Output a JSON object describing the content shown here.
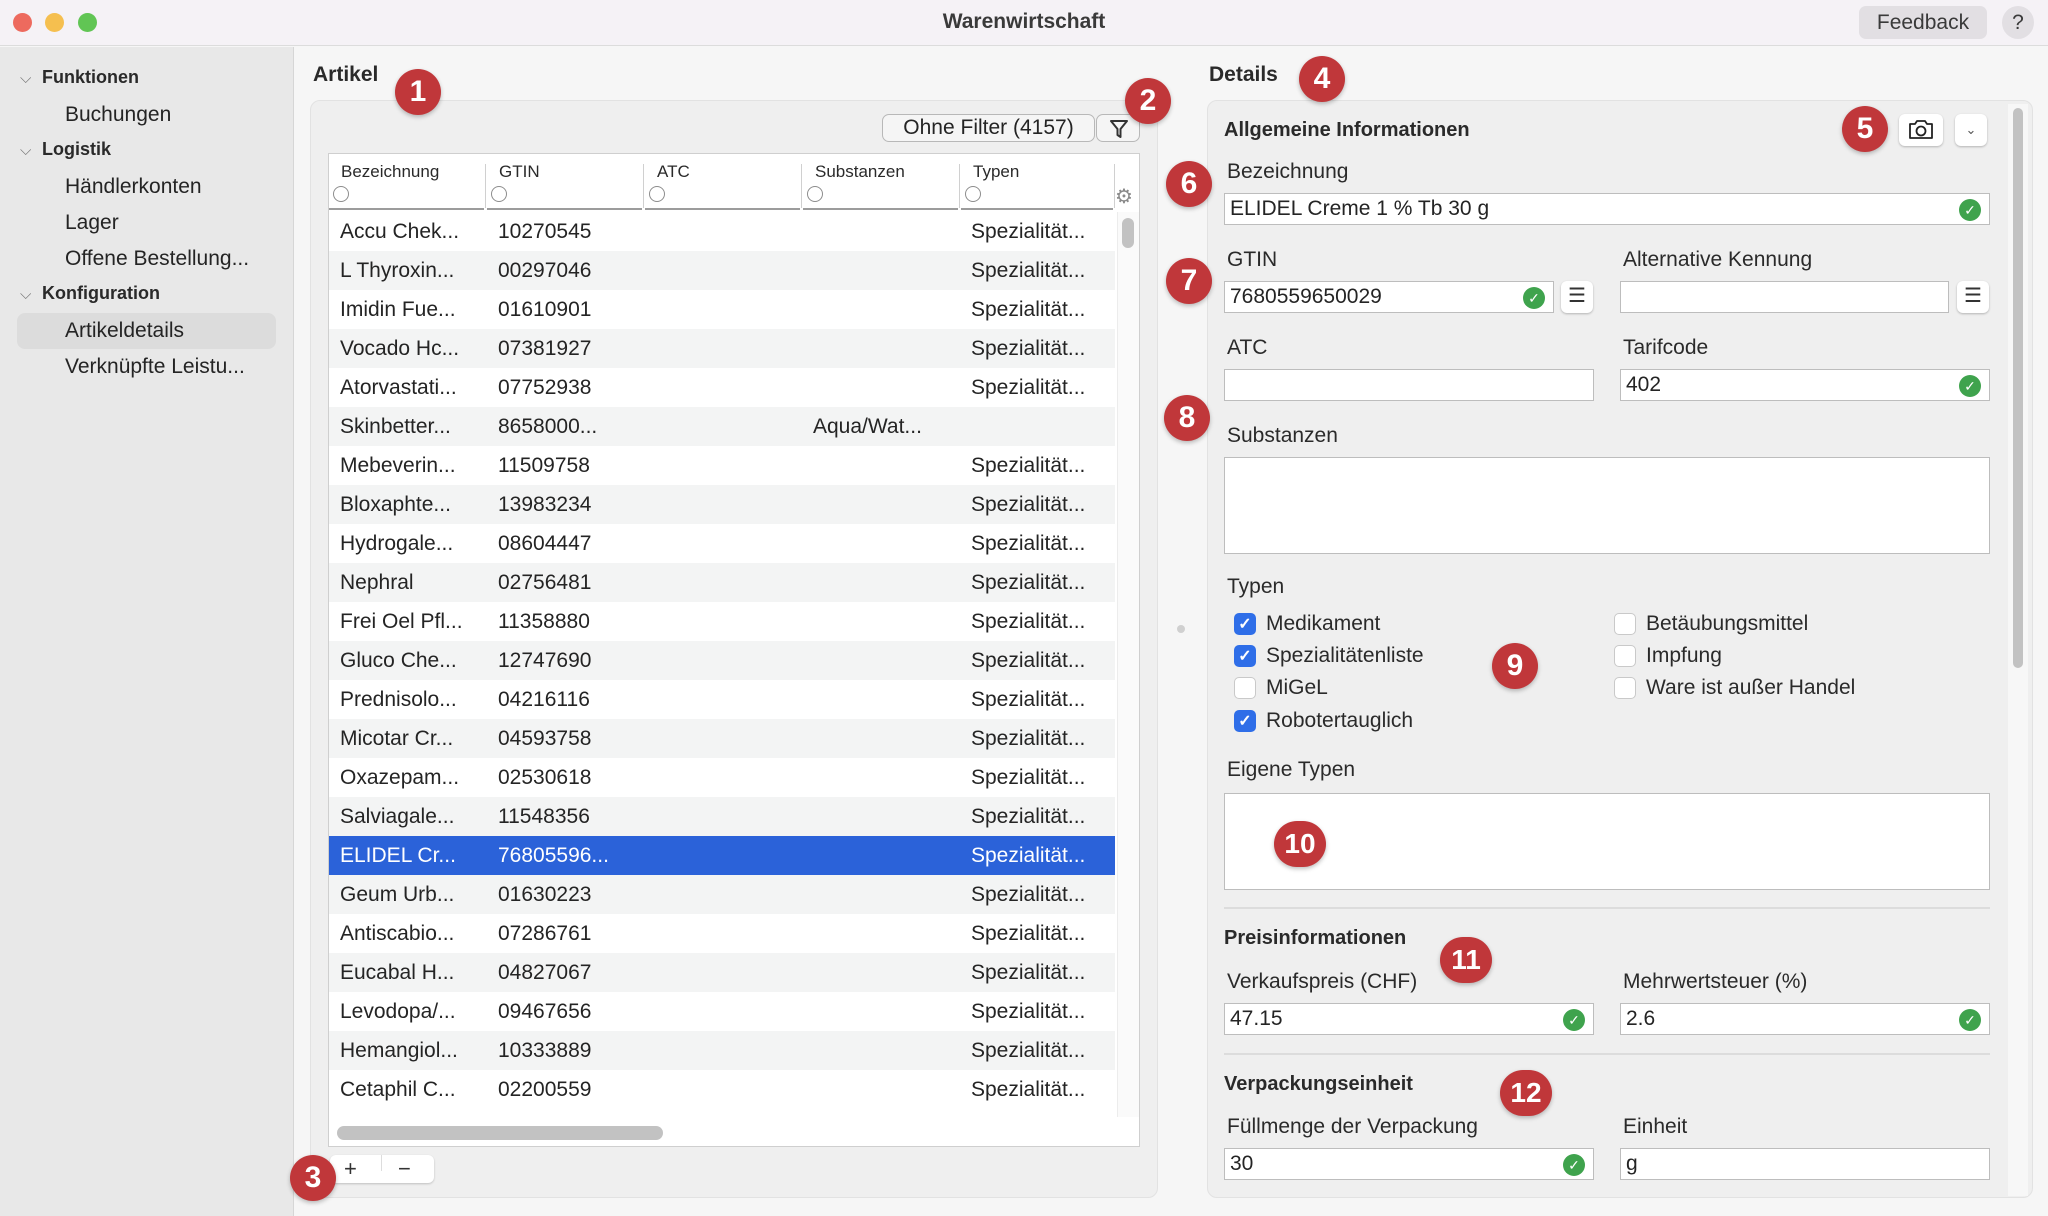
{
  "window": {
    "title": "Warenwirtschaft",
    "feedback_label": "Feedback",
    "help_label": "?"
  },
  "sidebar": {
    "groups": [
      {
        "label": "Funktionen",
        "items": [
          "Buchungen"
        ]
      },
      {
        "label": "Logistik",
        "items": [
          "Händlerkonten",
          "Lager",
          "Offene Bestellung..."
        ]
      },
      {
        "label": "Konfiguration",
        "items": [
          "Artikeldetails",
          "Verknüpfte Leistu..."
        ]
      }
    ],
    "active_item": "Artikeldetails"
  },
  "artikel": {
    "title": "Artikel",
    "filter_label": "Ohne Filter (4157)",
    "columns": [
      "Bezeichnung",
      "GTIN",
      "ATC",
      "Substanzen",
      "Typen"
    ],
    "rows": [
      [
        "Accu Chek...",
        "10270545",
        "",
        "",
        "Spezialität..."
      ],
      [
        "L Thyroxin...",
        "00297046",
        "",
        "",
        "Spezialität..."
      ],
      [
        "Imidin Fue...",
        "01610901",
        "",
        "",
        "Spezialität..."
      ],
      [
        "Vocado Hc...",
        "07381927",
        "",
        "",
        "Spezialität..."
      ],
      [
        "Atorvastati...",
        "07752938",
        "",
        "",
        "Spezialität..."
      ],
      [
        "Skinbetter...",
        "8658000...",
        "",
        "Aqua/Wat...",
        ""
      ],
      [
        "Mebeverin...",
        "11509758",
        "",
        "",
        "Spezialität..."
      ],
      [
        "Bloxaphte...",
        "13983234",
        "",
        "",
        "Spezialität..."
      ],
      [
        "Hydrogale...",
        "08604447",
        "",
        "",
        "Spezialität..."
      ],
      [
        "Nephral",
        "02756481",
        "",
        "",
        "Spezialität..."
      ],
      [
        "Frei Oel Pfl...",
        "11358880",
        "",
        "",
        "Spezialität..."
      ],
      [
        "Gluco Che...",
        "12747690",
        "",
        "",
        "Spezialität..."
      ],
      [
        "Prednisolo...",
        "04216116",
        "",
        "",
        "Spezialität..."
      ],
      [
        "Micotar Cr...",
        "04593758",
        "",
        "",
        "Spezialität..."
      ],
      [
        "Oxazepam...",
        "02530618",
        "",
        "",
        "Spezialität..."
      ],
      [
        "Salviagale...",
        "11548356",
        "",
        "",
        "Spezialität..."
      ],
      [
        "ELIDEL Cr...",
        "76805596...",
        "",
        "",
        "Spezialität..."
      ],
      [
        "Geum Urb...",
        "01630223",
        "",
        "",
        "Spezialität..."
      ],
      [
        "Antiscabio...",
        "07286761",
        "",
        "",
        "Spezialität..."
      ],
      [
        "Eucabal H...",
        "04827067",
        "",
        "",
        "Spezialität..."
      ],
      [
        "Levodopa/...",
        "09467656",
        "",
        "",
        "Spezialität..."
      ],
      [
        "Hemangiol...",
        "10333889",
        "",
        "",
        "Spezialität..."
      ],
      [
        "Cetaphil C...",
        "02200559",
        "",
        "",
        "Spezialität..."
      ]
    ],
    "selected_row": 16,
    "add_label": "+",
    "remove_label": "−"
  },
  "details": {
    "title": "Details",
    "general": {
      "title": "Allgemeine Informationen",
      "bezeichnung_label": "Bezeichnung",
      "bezeichnung_value": "ELIDEL Creme 1 % Tb 30 g",
      "gtin_label": "GTIN",
      "gtin_value": "7680559650029",
      "alt_label": "Alternative Kennung",
      "alt_value": "",
      "atc_label": "ATC",
      "atc_value": "",
      "tarif_label": "Tarifcode",
      "tarif_value": "402",
      "substanzen_label": "Substanzen",
      "typen_label": "Typen",
      "typen": [
        {
          "label": "Medikament",
          "checked": true
        },
        {
          "label": "Spezialitätenliste",
          "checked": true
        },
        {
          "label": "MiGeL",
          "checked": false
        },
        {
          "label": "Robotertauglich",
          "checked": true
        },
        {
          "label": "Betäubungsmittel",
          "checked": false
        },
        {
          "label": "Impfung",
          "checked": false
        },
        {
          "label": "Ware ist außer Handel",
          "checked": false
        }
      ],
      "eigene_typen_label": "Eigene Typen"
    },
    "price": {
      "title": "Preisinformationen",
      "verkaufspreis_label": "Verkaufspreis (CHF)",
      "verkaufspreis_value": "47.15",
      "mwst_label": "Mehrwertsteuer (%)",
      "mwst_value": "2.6"
    },
    "packaging": {
      "title": "Verpackungseinheit",
      "fuellmenge_label": "Füllmenge der Verpackung",
      "fuellmenge_value": "30",
      "einheit_label": "Einheit",
      "einheit_value": "g"
    }
  },
  "annotations": [
    "1",
    "2",
    "3",
    "4",
    "5",
    "6",
    "7",
    "8",
    "9",
    "10",
    "11",
    "12"
  ],
  "colors": {
    "selection": "#2b62d9",
    "badge": "#c0373a",
    "valid": "#3fa34d",
    "checkbox": "#2f6ee8"
  }
}
